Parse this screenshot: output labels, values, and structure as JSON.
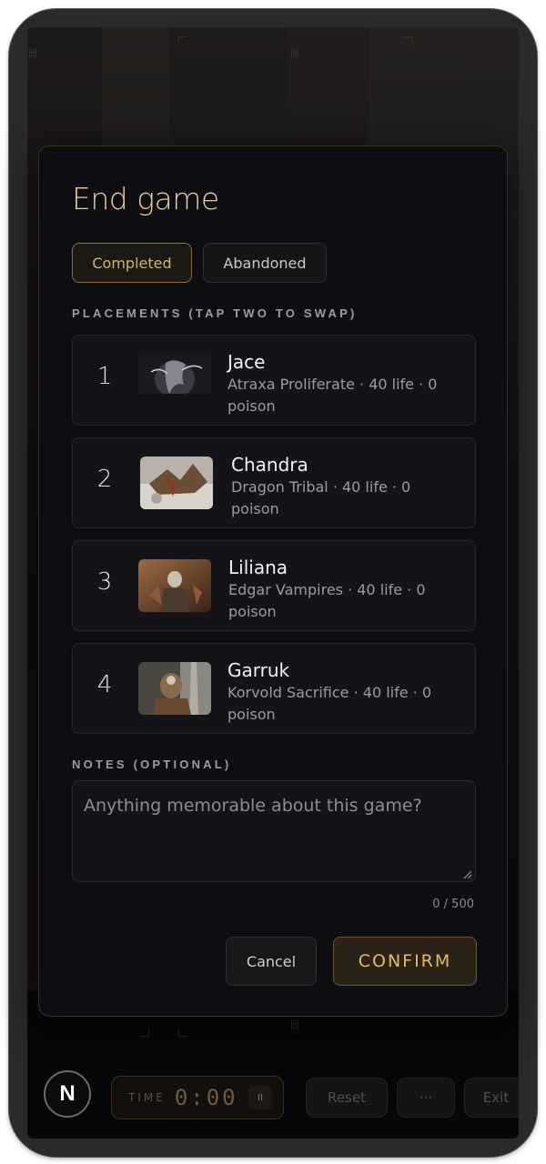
{
  "modal": {
    "title": "End game",
    "status_tabs": {
      "completed": "Completed",
      "abandoned": "Abandoned",
      "selected": "Completed"
    },
    "placements_label": "PLACEMENTS (TAP TWO TO SWAP)",
    "players": [
      {
        "rank": "1",
        "name": "Jace",
        "detail": "Atraxa Proliferate · 40 life · 0 poison"
      },
      {
        "rank": "2",
        "name": "Chandra",
        "detail": "Dragon Tribal · 40 life · 0 poison"
      },
      {
        "rank": "3",
        "name": "Liliana",
        "detail": "Edgar Vampires · 40 life · 0 poison"
      },
      {
        "rank": "4",
        "name": "Garruk",
        "detail": "Korvold Sacrifice · 40 life · 0 poison"
      }
    ],
    "notes_label": "NOTES (OPTIONAL)",
    "notes_placeholder": "Anything memorable about this game?",
    "notes_counter": "0 / 500",
    "cancel_label": "Cancel",
    "confirm_label": "CONFIRM"
  },
  "background": {
    "logo_letter": "N",
    "timer_label": "TIME",
    "timer_value": "0:00",
    "pause_glyph": "II",
    "reset_label": "Reset",
    "more_label": "···",
    "exit_label": "Exit",
    "tally_mark": "卌"
  },
  "colors": {
    "accent_gold": "#e2b86e",
    "modal_bg": "#0e0e12",
    "card_bg": "#141418"
  }
}
